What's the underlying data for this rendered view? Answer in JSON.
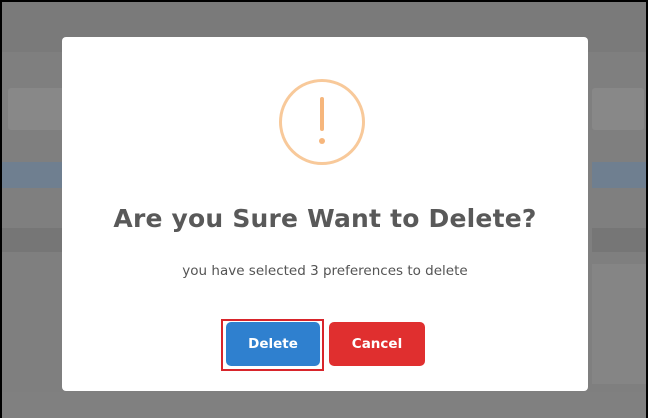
{
  "dialog": {
    "title": "Are you Sure Want to Delete?",
    "message": "you have selected 3 preferences to delete",
    "delete_label": "Delete",
    "cancel_label": "Cancel",
    "icon": "warning-exclamation-icon"
  },
  "colors": {
    "delete_button": "#2f80cf",
    "cancel_button": "#e02f2f",
    "warning_icon": "#f6b67c",
    "highlight_box": "#d8252b",
    "overlay": "#7f7f7f"
  }
}
